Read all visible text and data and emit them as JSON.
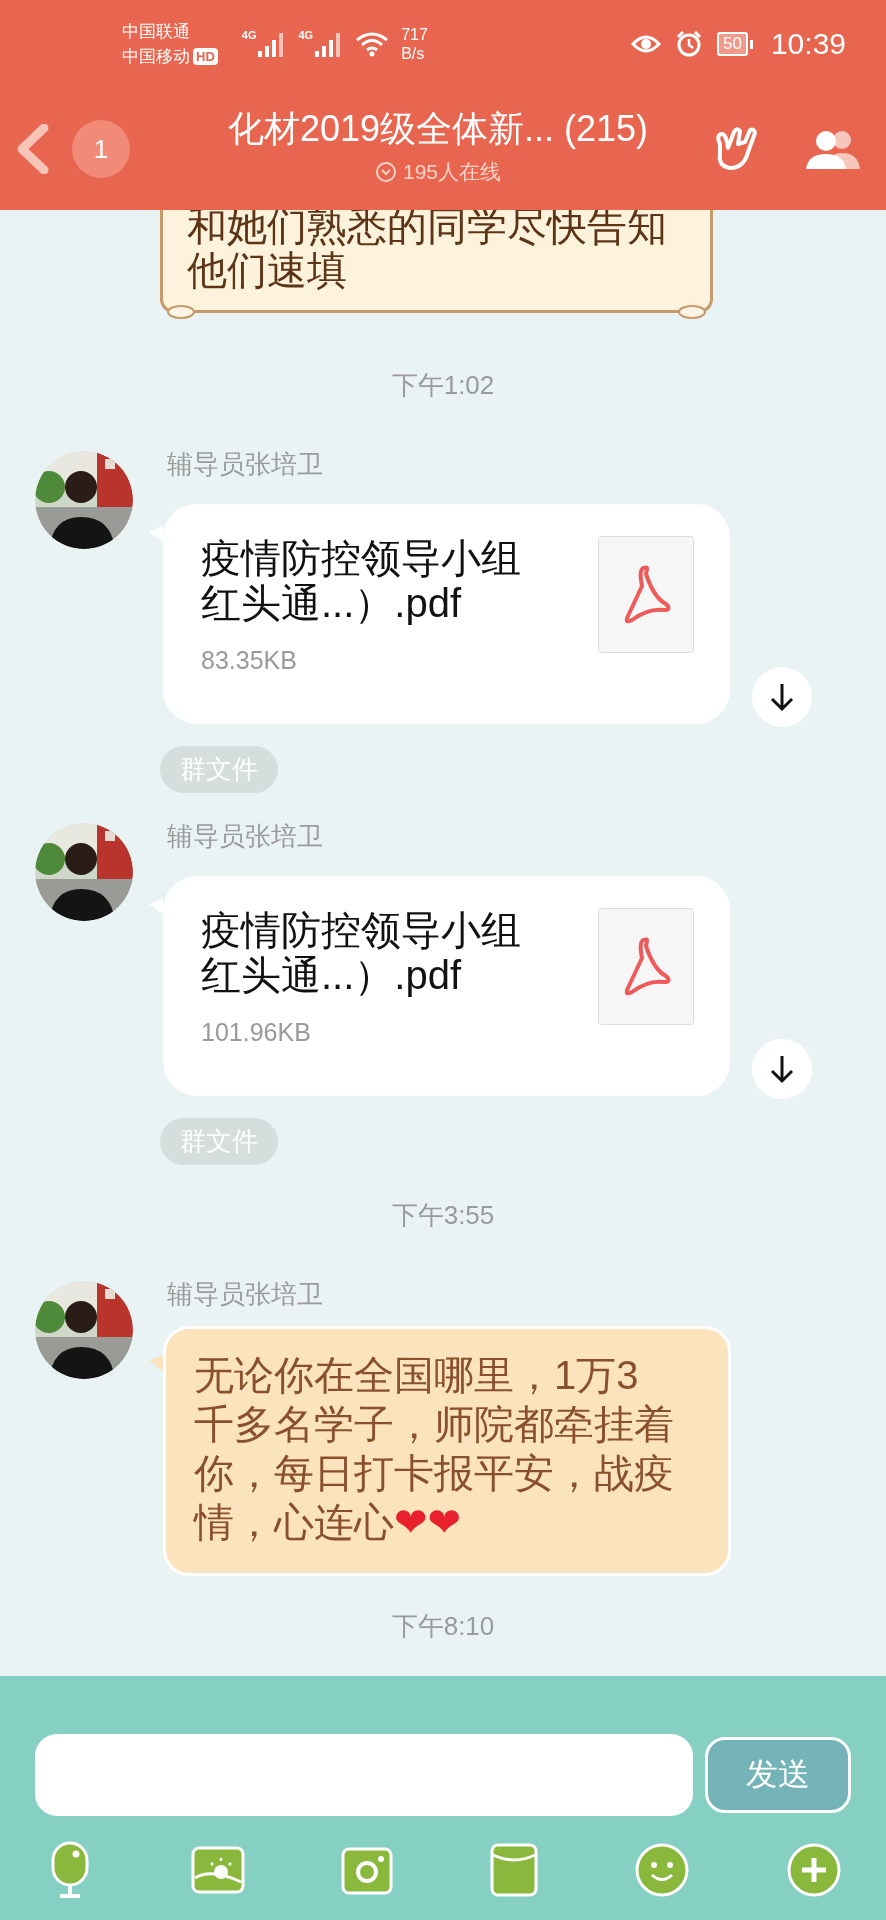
{
  "status_bar": {
    "carriers": [
      "中国联通",
      "中国移动"
    ],
    "hd_badge": "HD",
    "networks": [
      "4G",
      "4G"
    ],
    "speed": "717",
    "speed_unit": "B/s",
    "battery": "50",
    "time": "10:39"
  },
  "header": {
    "back_badge": "1",
    "title": "化材2019级全体新... (215)",
    "online": "195人在线"
  },
  "messages": [
    {
      "kind": "notice",
      "text": "和她们熟悉的同学尽快告知他们速填"
    },
    {
      "kind": "time",
      "text": "下午1:02"
    },
    {
      "kind": "file",
      "sender": "辅导员张培卫",
      "file_name": "疫情防控领导小组红头通...）.pdf",
      "size": "83.35KB",
      "tag": "群文件"
    },
    {
      "kind": "file",
      "sender": "辅导员张培卫",
      "file_name": "疫情防控领导小组红头通...）.pdf",
      "size": "101.96KB",
      "tag": "群文件"
    },
    {
      "kind": "time",
      "text": "下午3:55"
    },
    {
      "kind": "text",
      "sender": "辅导员张培卫",
      "text": "无论你在全国哪里，1万3千多名学子，师院都牵挂着你，每日打卡报平安，战疫情，心连心",
      "emoji": "❤❤"
    },
    {
      "kind": "time",
      "text": "下午8:10"
    }
  ],
  "composer": {
    "send": "发送"
  }
}
